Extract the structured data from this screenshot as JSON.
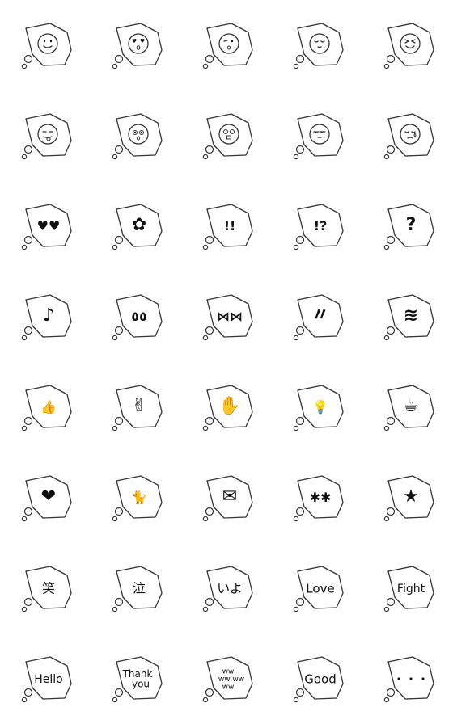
{
  "colors": {
    "stroke": "#333333",
    "fill": "#111111",
    "background": "#ffffff"
  },
  "stickers": [
    {
      "icon": "smile-face-icon",
      "kind": "face",
      "face": "smile"
    },
    {
      "icon": "heart-eyes-face-icon",
      "kind": "face",
      "face": "hearteyes"
    },
    {
      "icon": "wink-kiss-face-icon",
      "kind": "face",
      "face": "wink"
    },
    {
      "icon": "content-face-icon",
      "kind": "face",
      "face": "content"
    },
    {
      "icon": "squint-face-icon",
      "kind": "face",
      "face": "squint"
    },
    {
      "icon": "tongue-face-icon",
      "kind": "face",
      "face": "tongue"
    },
    {
      "icon": "surprised-face-icon",
      "kind": "face",
      "face": "surprised"
    },
    {
      "icon": "shocked-face-icon",
      "kind": "face",
      "face": "shocked"
    },
    {
      "icon": "unamused-face-icon",
      "kind": "face",
      "face": "unamused"
    },
    {
      "icon": "crying-face-icon",
      "kind": "face",
      "face": "crying"
    },
    {
      "icon": "hearts-icon",
      "kind": "glyph",
      "glyph": "♥♥"
    },
    {
      "icon": "flower-icon",
      "kind": "glyph",
      "glyph": "✿"
    },
    {
      "icon": "double-exclamation-icon",
      "kind": "glyph",
      "glyph": "!!"
    },
    {
      "icon": "exclamation-question-icon",
      "kind": "glyph",
      "glyph": "!?"
    },
    {
      "icon": "question-mark-icon",
      "kind": "glyph",
      "glyph": "?"
    },
    {
      "icon": "music-note-icon",
      "kind": "glyph",
      "glyph": "♪"
    },
    {
      "icon": "drops-icon",
      "kind": "glyph",
      "glyph": "٥٥"
    },
    {
      "icon": "bows-icon",
      "kind": "glyph",
      "glyph": "⋈⋈"
    },
    {
      "icon": "sweat-marks-icon",
      "kind": "glyph",
      "glyph": "〃"
    },
    {
      "icon": "zigzag-anger-icon",
      "kind": "glyph",
      "glyph": "≋"
    },
    {
      "icon": "thumbs-up-icon",
      "kind": "glyph",
      "glyph": "👍"
    },
    {
      "icon": "peace-bunny-icon",
      "kind": "glyph",
      "glyph": "✌"
    },
    {
      "icon": "waving-hand-icon",
      "kind": "glyph",
      "glyph": "✋"
    },
    {
      "icon": "lightbulb-icon",
      "kind": "glyph",
      "glyph": "💡"
    },
    {
      "icon": "coffee-cup-icon",
      "kind": "glyph",
      "glyph": "☕"
    },
    {
      "icon": "heart-balloon-icon",
      "kind": "glyph",
      "glyph": "❤"
    },
    {
      "icon": "cat-icon",
      "kind": "glyph",
      "glyph": "🐈"
    },
    {
      "icon": "envelope-icon",
      "kind": "glyph",
      "glyph": "✉"
    },
    {
      "icon": "sparkles-icon",
      "kind": "glyph",
      "glyph": "✱✱"
    },
    {
      "icon": "star-icon",
      "kind": "glyph",
      "glyph": "★"
    },
    {
      "icon": "text-bubble-icon",
      "kind": "text",
      "text": "笑"
    },
    {
      "icon": "text-bubble-icon",
      "kind": "text",
      "text": "泣"
    },
    {
      "icon": "text-bubble-icon",
      "kind": "text",
      "text": "いよ"
    },
    {
      "icon": "text-bubble-icon",
      "kind": "text",
      "text": "Love"
    },
    {
      "icon": "text-bubble-icon",
      "kind": "text",
      "text": "Fight"
    },
    {
      "icon": "text-bubble-icon",
      "kind": "text",
      "text": "Hello"
    },
    {
      "icon": "text-bubble-icon",
      "kind": "text",
      "text": "Thank you"
    },
    {
      "icon": "text-bubble-icon",
      "kind": "text",
      "text": "ww ww ww"
    },
    {
      "icon": "text-bubble-icon",
      "kind": "text",
      "text": "Good"
    },
    {
      "icon": "text-bubble-icon",
      "kind": "text",
      "text": "・・・"
    }
  ]
}
